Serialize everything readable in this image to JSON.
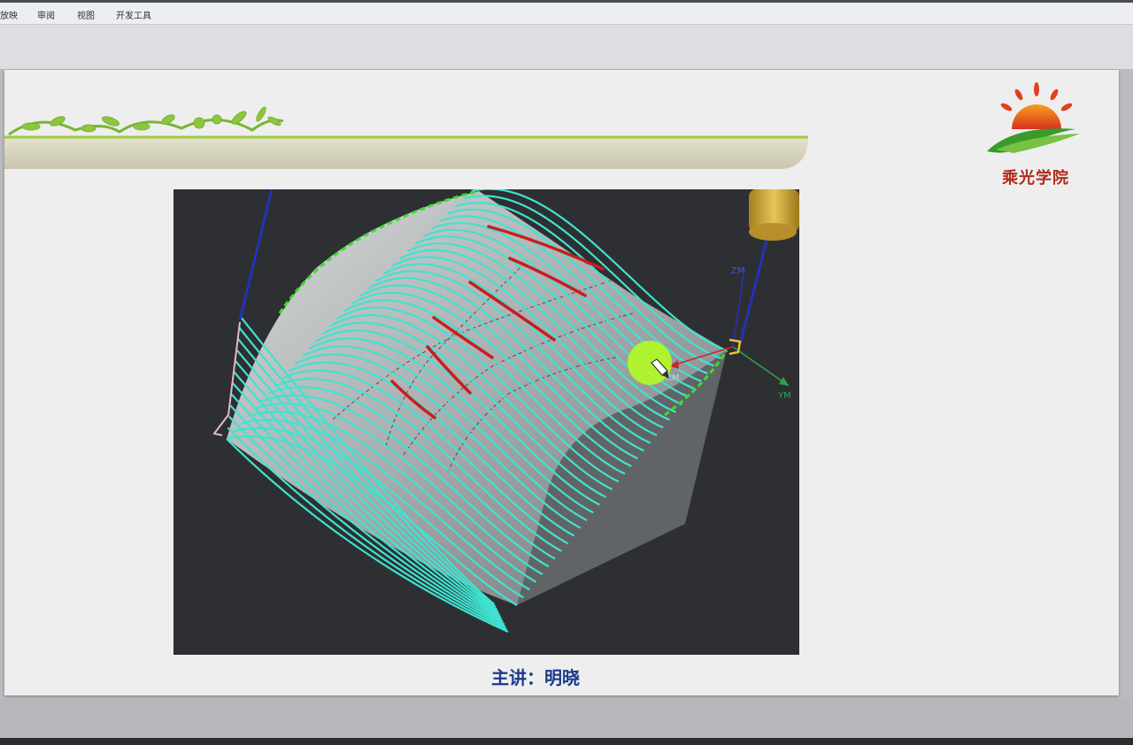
{
  "menu": {
    "items": [
      "放映",
      "审阅",
      "视图",
      "开发工具"
    ]
  },
  "slide": {
    "logo_text": "乘光学院",
    "speaker": "主讲：明晓"
  },
  "viewport": {
    "axis_labels": {
      "zm": "ZM",
      "xm": "XM",
      "ym": "YM"
    }
  },
  "colors": {
    "toolpath": "#3fe3d0",
    "markup": "#c81e1e",
    "cursor_highlight": "#b6ff1a",
    "logo_red": "#b22a1c",
    "speaker_blue": "#1a3a8c"
  }
}
